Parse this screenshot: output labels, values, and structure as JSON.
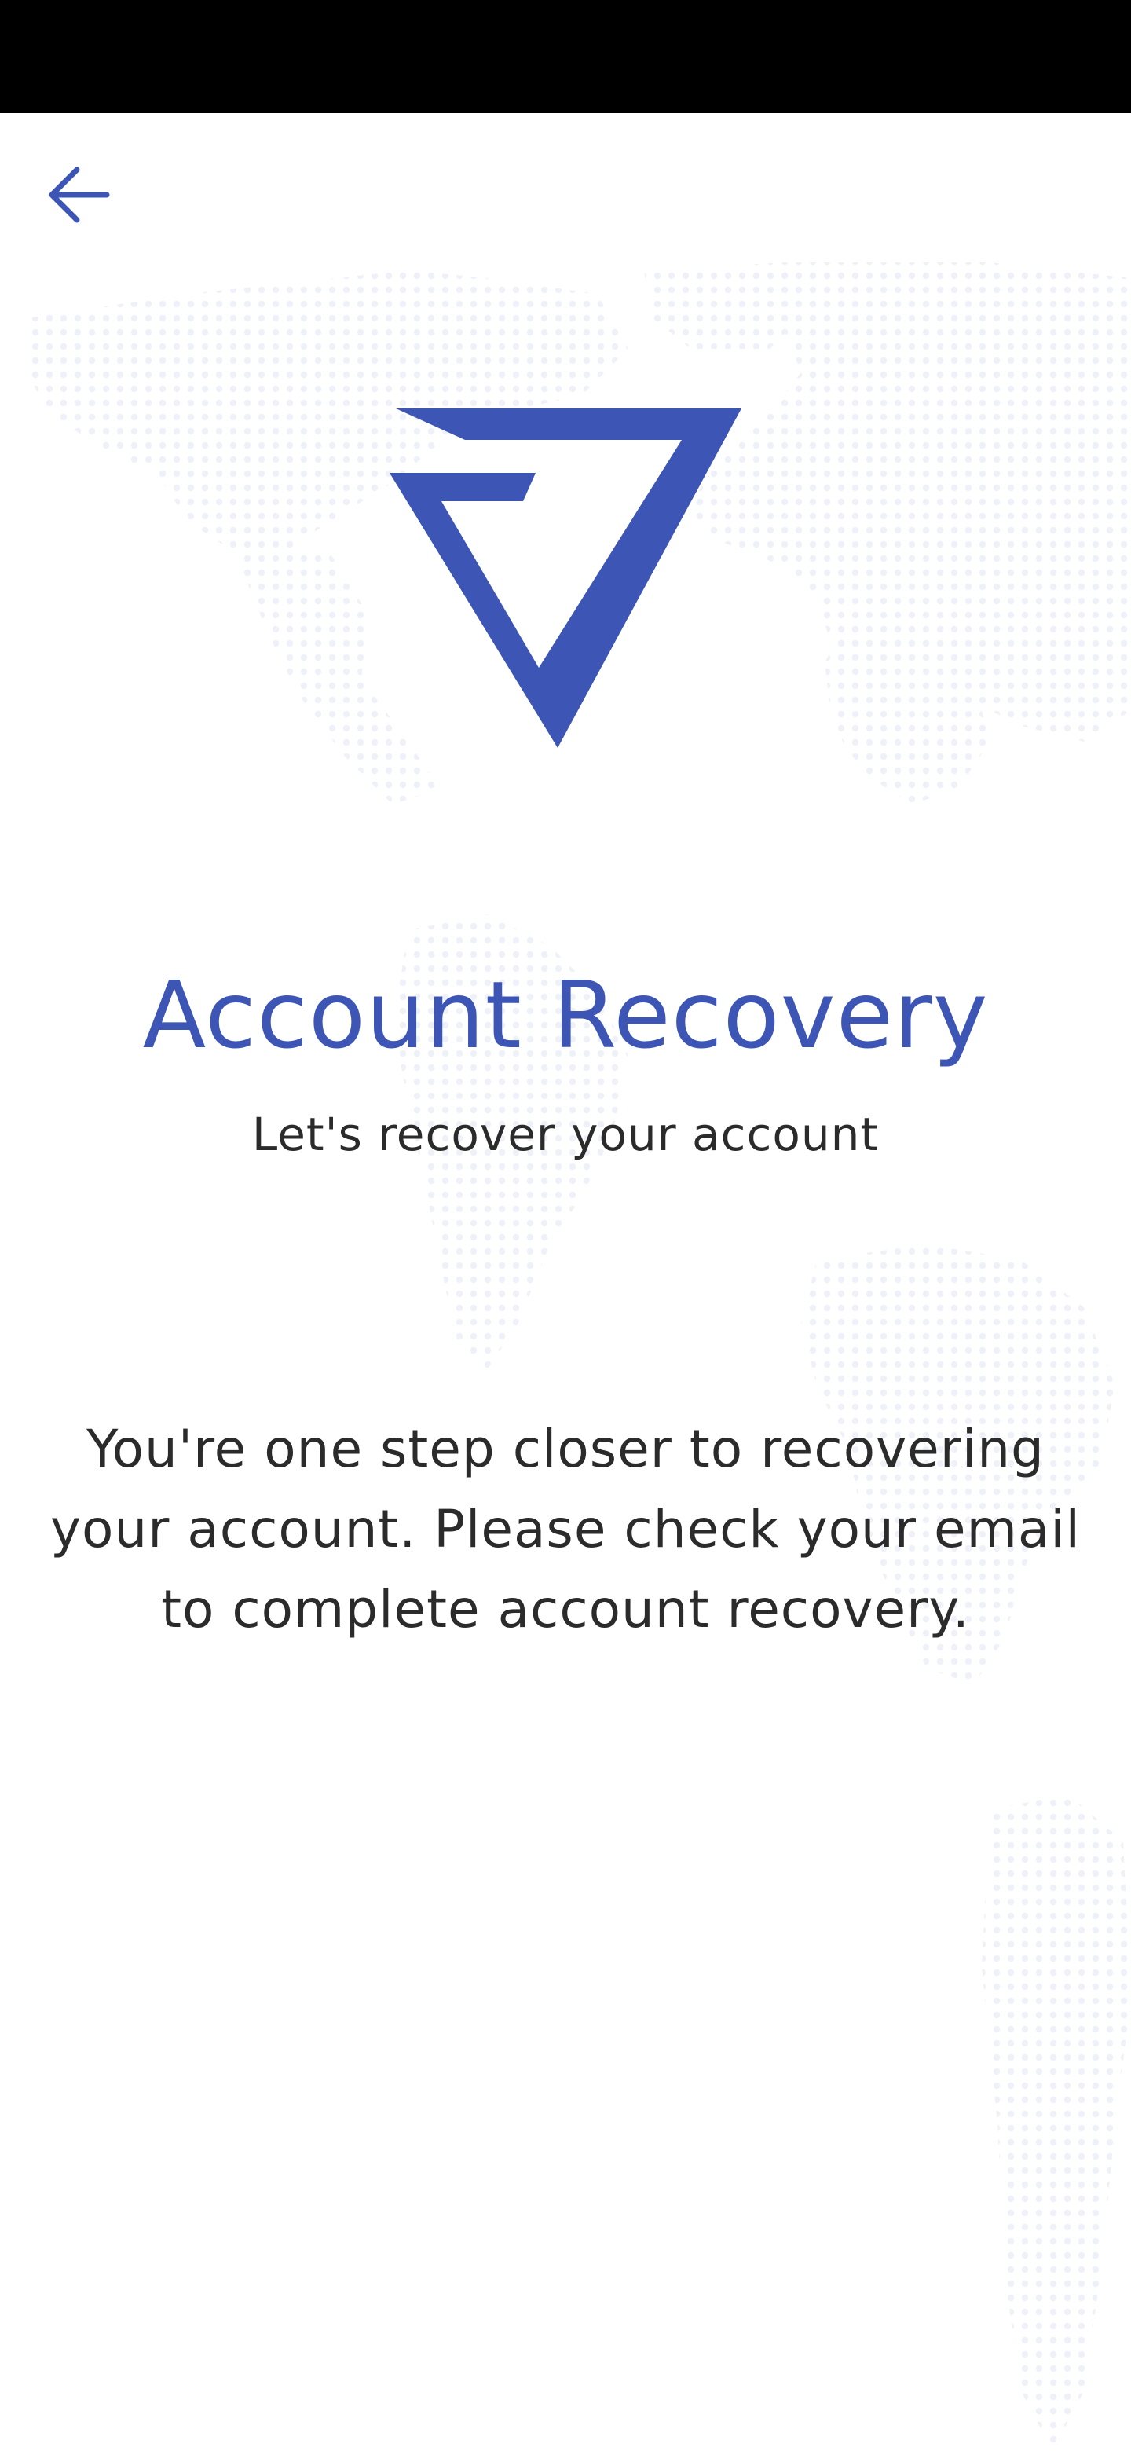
{
  "header": {
    "back_icon": "arrow-left-icon"
  },
  "brand": {
    "logo_icon": "triangle-logo-icon",
    "accent_color": "#3d56b6"
  },
  "content": {
    "title": "Account Recovery",
    "subtitle": "Let's recover your account",
    "message": "You're one step closer to recovering your account. Please check your email to complete account recovery."
  }
}
